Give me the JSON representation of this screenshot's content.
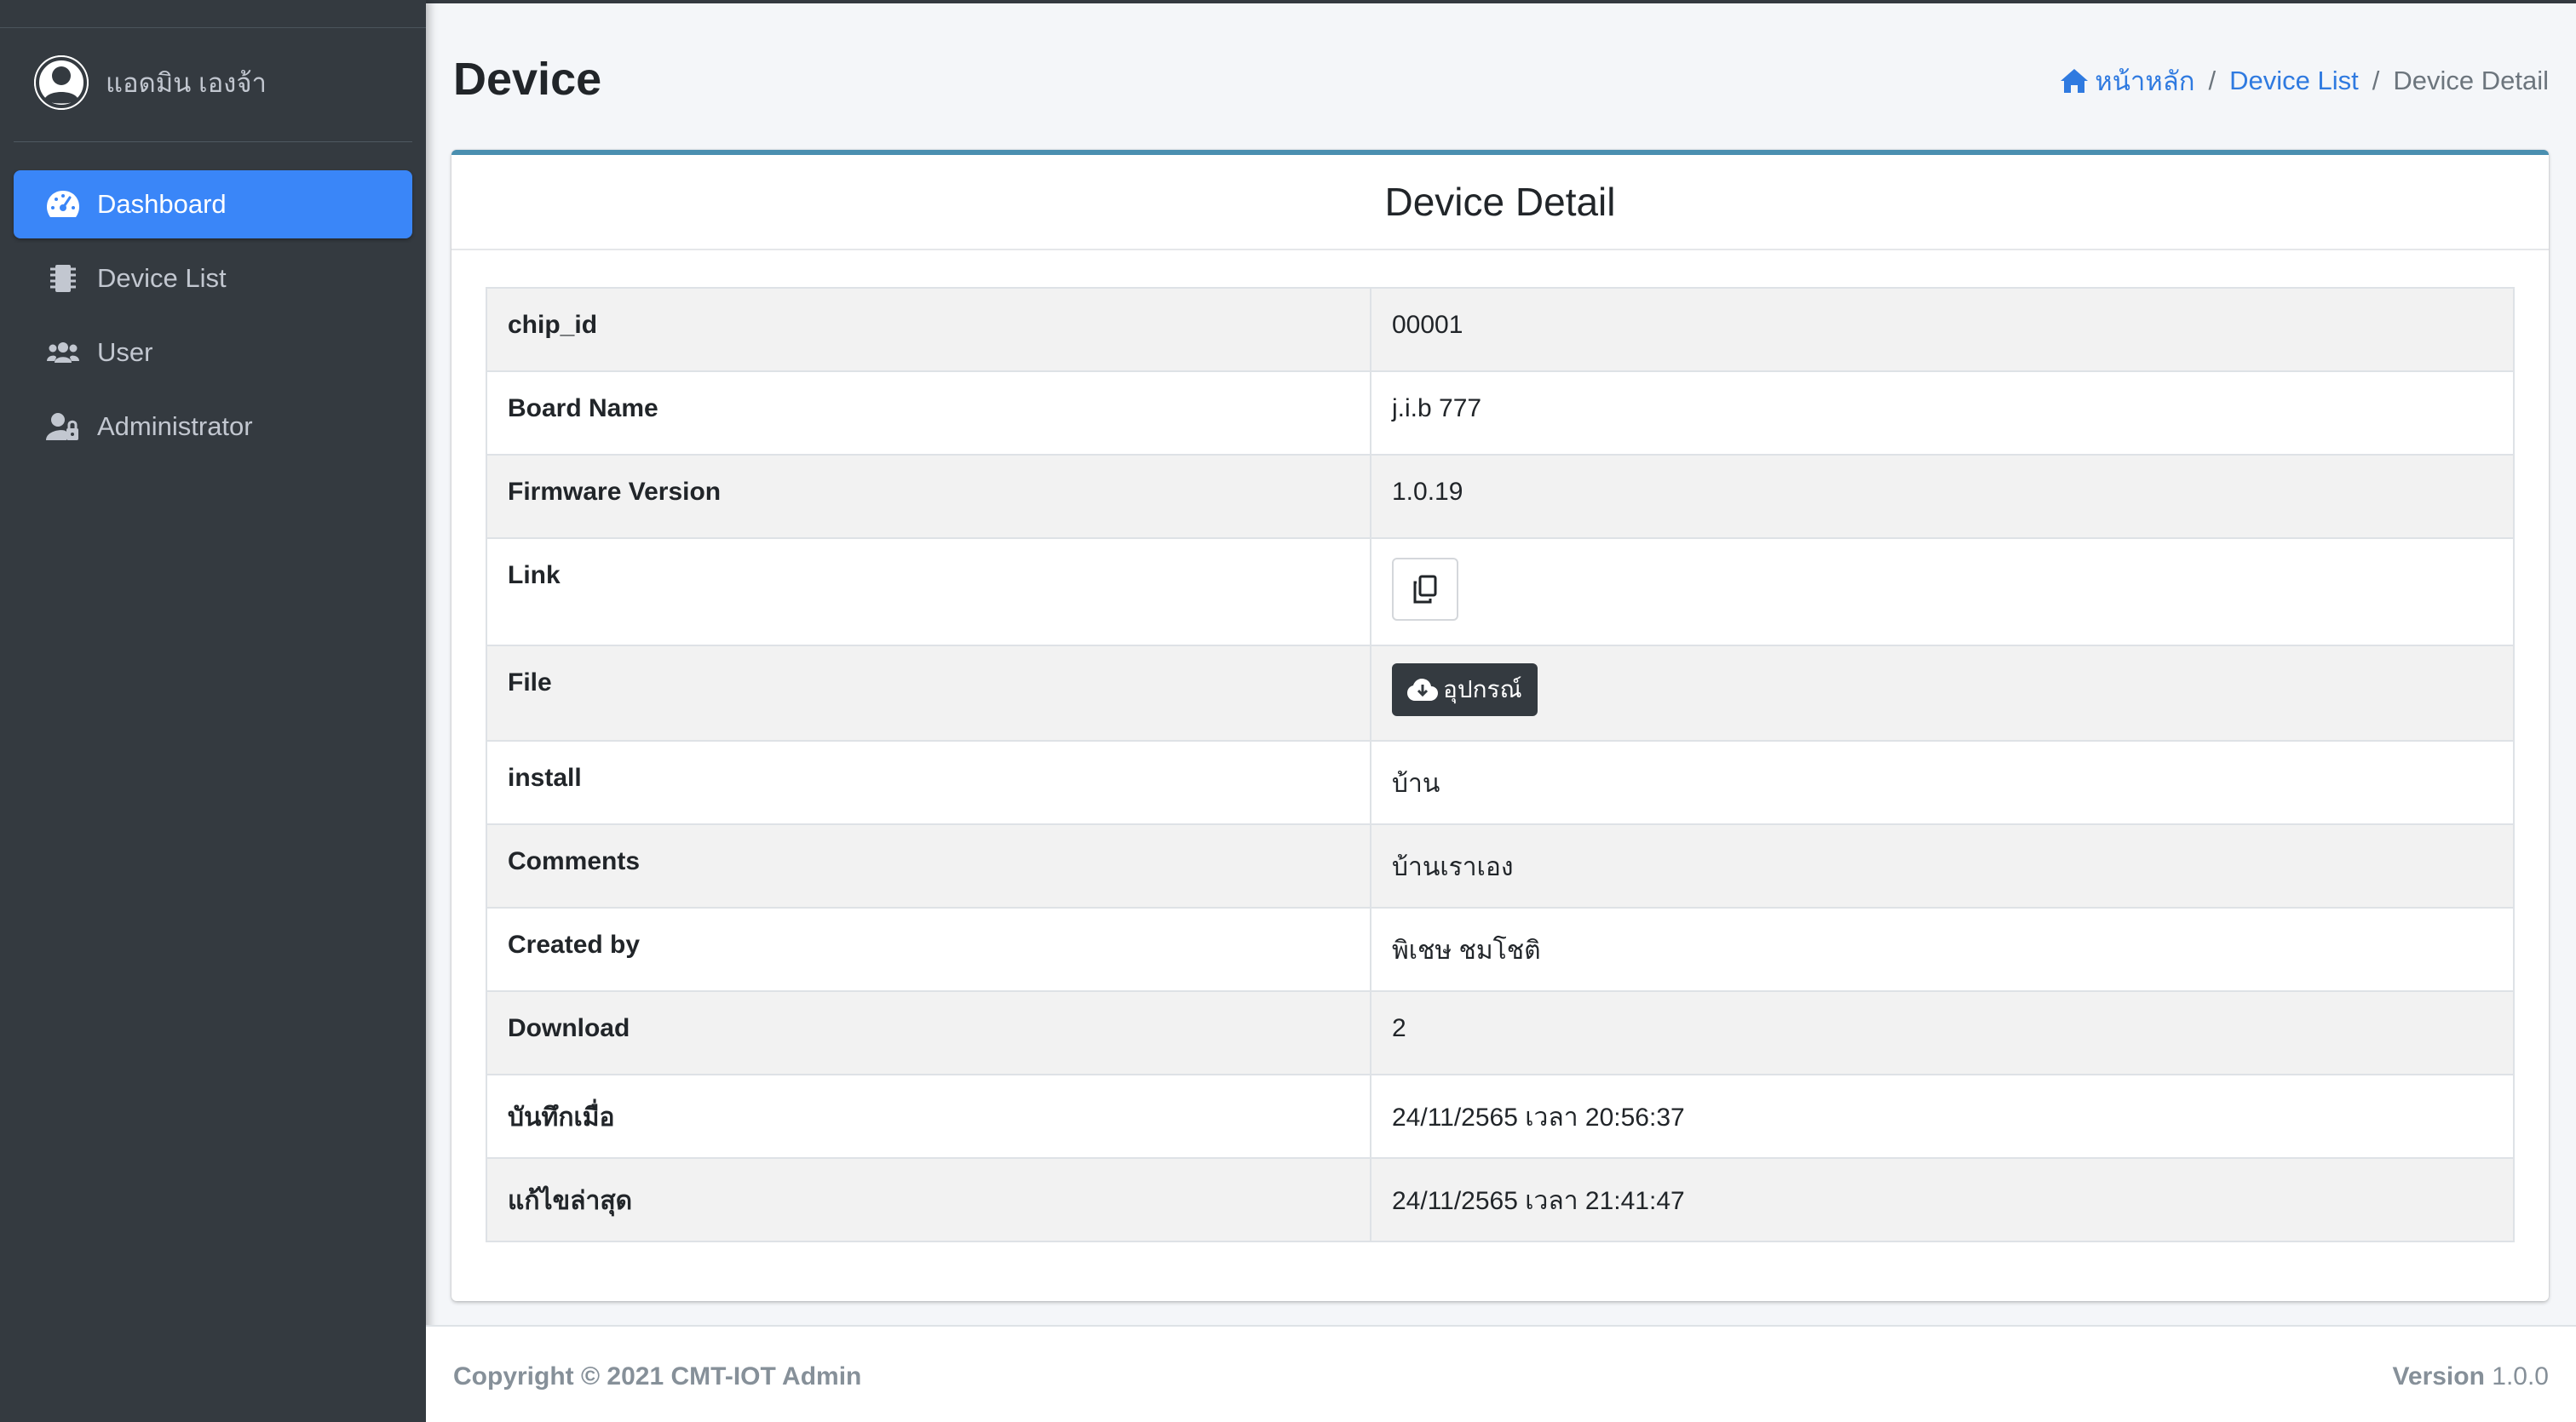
{
  "sidebar": {
    "user_name": "แอดมิน เองจ้า",
    "items": [
      {
        "label": "Dashboard",
        "icon": "tachometer-icon",
        "active": true
      },
      {
        "label": "Device List",
        "icon": "microchip-icon",
        "active": false
      },
      {
        "label": "User",
        "icon": "users-icon",
        "active": false
      },
      {
        "label": "Administrator",
        "icon": "user-lock-icon",
        "active": false
      }
    ]
  },
  "header": {
    "title": "Device",
    "breadcrumb": {
      "home": "หน้าหลัก",
      "device_list": "Device List",
      "current": "Device Detail"
    }
  },
  "card": {
    "title": "Device Detail",
    "rows": [
      {
        "key": "chip_id",
        "value": "00001"
      },
      {
        "key": "Board Name",
        "value": "j.i.b 777"
      },
      {
        "key": "Firmware Version",
        "value": "1.0.19"
      },
      {
        "key": "Link",
        "value": ""
      },
      {
        "key": "File",
        "value": "",
        "button_label": "อุปกรณ์"
      },
      {
        "key": "install",
        "value": "บ้าน"
      },
      {
        "key": "Comments",
        "value": "บ้านเราเอง"
      },
      {
        "key": "Created by",
        "value": "พิเชษ ชมโชติ"
      },
      {
        "key": "Download",
        "value": "2"
      },
      {
        "key": "บันทึกเมื่อ",
        "value": "24/11/2565 เวลา 20:56:37"
      },
      {
        "key": "แก้ไขล่าสุด",
        "value": "24/11/2565 เวลา 21:41:47"
      }
    ]
  },
  "footer": {
    "copyright": "Copyright © 2021 CMT-IOT Admin",
    "version_label": "Version",
    "version_value": "1.0.0"
  },
  "colors": {
    "sidebar_bg": "#343a40",
    "active_nav": "#3a86f8",
    "card_top_border": "#4a8fb0",
    "link": "#2f7ae0"
  }
}
